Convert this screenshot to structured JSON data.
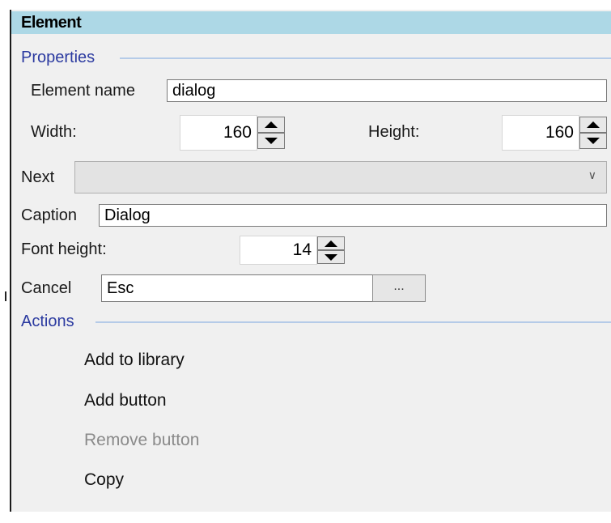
{
  "panel": {
    "title": "Element"
  },
  "properties": {
    "section_label": "Properties",
    "element_name_label": "Element name",
    "element_name_value": "dialog",
    "width_label": "Width:",
    "width_value": "160",
    "height_label": "Height:",
    "height_value": "160",
    "next_label": "Next",
    "next_value": "",
    "caption_label": "Caption",
    "caption_value": "Dialog",
    "font_height_label": "Font height:",
    "font_height_value": "14",
    "cancel_label": "Cancel",
    "cancel_value": "Esc",
    "browse_button_label": "..."
  },
  "actions": {
    "section_label": "Actions",
    "items": [
      {
        "label": "Add to library",
        "enabled": true
      },
      {
        "label": "Add button",
        "enabled": true
      },
      {
        "label": "Remove button",
        "enabled": false
      },
      {
        "label": "Copy",
        "enabled": true
      }
    ]
  },
  "colors": {
    "header_bg": "#add8e6",
    "section_text": "#2b3aa0",
    "section_rule": "#b5cbe8",
    "panel_bg": "#f0f0f0",
    "disabled_text": "#8a8a8a"
  }
}
